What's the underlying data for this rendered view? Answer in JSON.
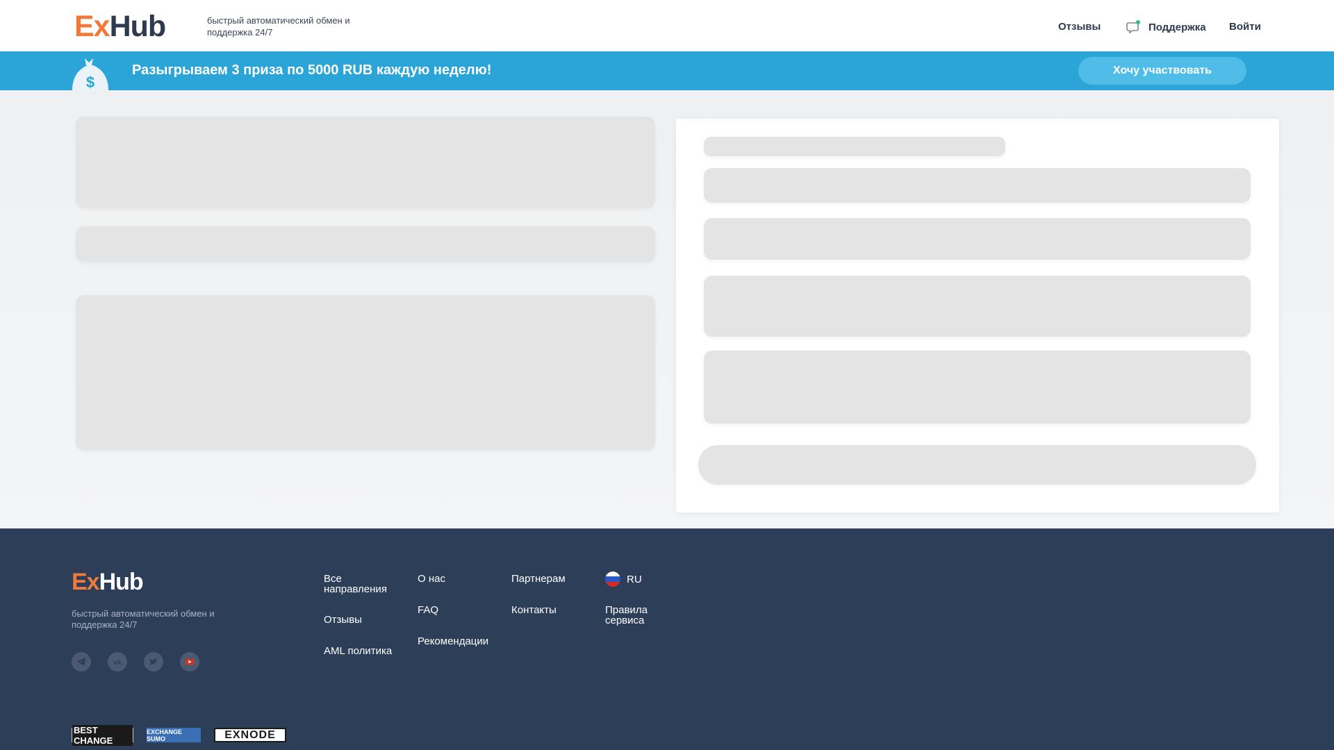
{
  "header": {
    "logo_ex": "Ex",
    "logo_hub": "Hub",
    "tagline": "быстрый автоматический обмен и поддержка 24/7",
    "nav": {
      "reviews": "Отзывы",
      "support": "Поддержка",
      "login": "Войти"
    }
  },
  "promo": {
    "text": "Разыгрываем 3 приза по 5000 RUB каждую неделю!",
    "button": "Хочу участвовать",
    "icon": "money-bag-icon"
  },
  "footer": {
    "logo_ex": "Ex",
    "logo_hub": "Hub",
    "tagline": "быстрый автоматический обмен и поддержка 24/7",
    "social": [
      "telegram-icon",
      "vk-icon",
      "twitter-icon",
      "youtube-icon"
    ],
    "links": {
      "all_directions": "Все направления",
      "reviews": "Отзывы",
      "aml": "AML политика",
      "about": "О нас",
      "faq": "FAQ",
      "recommendations": "Рекомендации",
      "partners": "Партнерам",
      "contacts": "Контакты",
      "rules": "Правила сервиса"
    },
    "language": "RU",
    "partners": [
      "BEST CHANGE",
      "EXCHANGE SUMO",
      "EXNODE"
    ]
  },
  "colors": {
    "accent_orange": "#f07a3a",
    "promo_blue": "#2ba4d8",
    "footer_bg": "#2d3e58",
    "skeleton": "#e4e4e4"
  }
}
